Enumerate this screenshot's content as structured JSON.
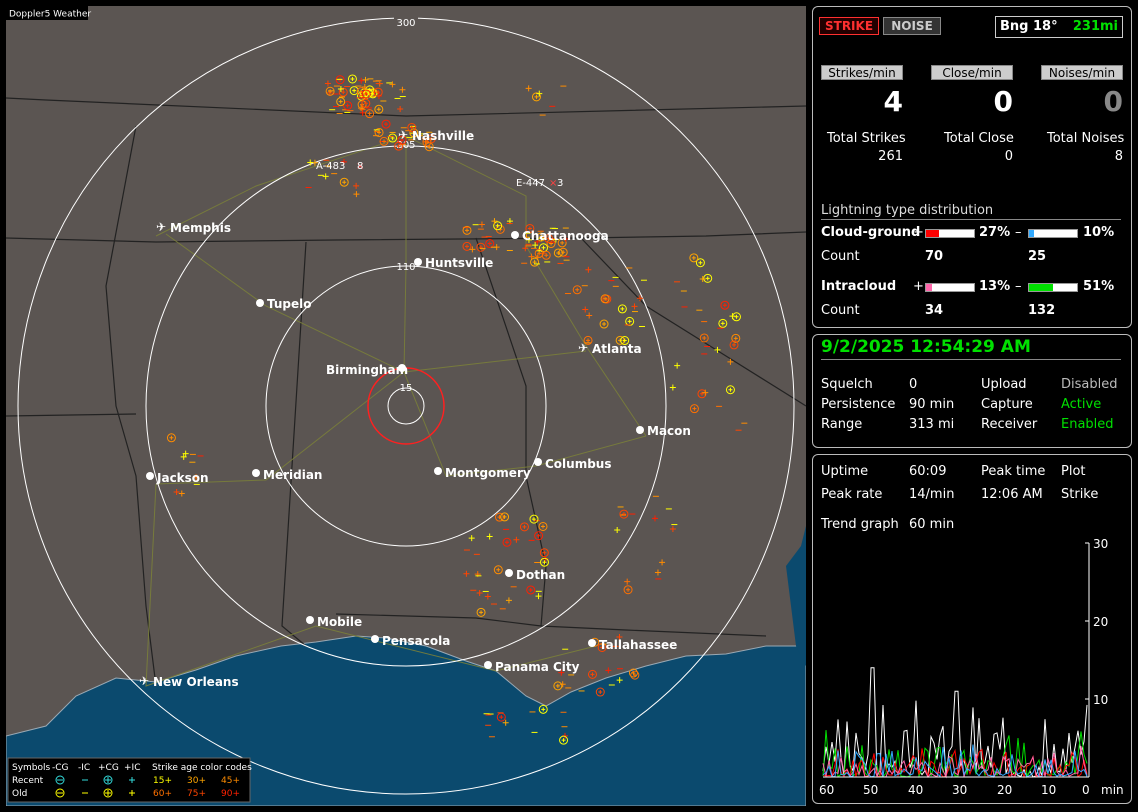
{
  "app_title": "Doppler5 Weather",
  "map": {
    "range_labels": [
      "300",
      "205",
      "110",
      "15"
    ],
    "cities": [
      {
        "name": "Nashville",
        "kind": "airport"
      },
      {
        "name": "Memphis",
        "kind": "airport"
      },
      {
        "name": "Chattanooga",
        "kind": "dot"
      },
      {
        "name": "Huntsville",
        "kind": "dot"
      },
      {
        "name": "Tupelo",
        "kind": "dot"
      },
      {
        "name": "Atlanta",
        "kind": "airport"
      },
      {
        "name": "Birmingham",
        "kind": "dot"
      },
      {
        "name": "Macon",
        "kind": "dot"
      },
      {
        "name": "Jackson",
        "kind": "dot"
      },
      {
        "name": "Meridian",
        "kind": "dot"
      },
      {
        "name": "Montgomery",
        "kind": "dot"
      },
      {
        "name": "Columbus",
        "kind": "dot"
      },
      {
        "name": "Dothan",
        "kind": "dot"
      },
      {
        "name": "Mobile",
        "kind": "dot"
      },
      {
        "name": "Pensacola",
        "kind": "dot"
      },
      {
        "name": "Tallahassee",
        "kind": "dot"
      },
      {
        "name": "Panama City",
        "kind": "dot"
      },
      {
        "name": "New Orleans",
        "kind": "airport"
      }
    ],
    "markers": [
      {
        "name": "A-483",
        "count": "8"
      },
      {
        "name": "E-447",
        "count": "3"
      }
    ],
    "legend": {
      "symbols_label": "Symbols",
      "col_headers": [
        "-CG",
        "-IC",
        "+CG",
        "+IC"
      ],
      "recent_label": "Recent",
      "old_label": "Old",
      "age_title": "Strike age color codes",
      "recent_ages": [
        "15+",
        "30+",
        "45+"
      ],
      "old_ages": [
        "60+",
        "75+",
        "90+"
      ],
      "age_colors": [
        "#ffff00",
        "#ffa500",
        "#ff8c00",
        "#ff7000",
        "#ff4500",
        "#ff2000"
      ]
    }
  },
  "status": {
    "strike_label": "STRIKE",
    "noise_label": "NOISE",
    "bearing": "Bng 18°",
    "distance": "231mi",
    "rates": [
      {
        "label": "Strikes/min",
        "value": "4"
      },
      {
        "label": "Close/min",
        "value": "0"
      },
      {
        "label": "Noises/min",
        "value": "0"
      }
    ],
    "totals": [
      {
        "label": "Total Strikes",
        "value": "261"
      },
      {
        "label": "Total Close",
        "value": "0"
      },
      {
        "label": "Total Noises",
        "value": "8"
      }
    ],
    "distribution_title": "Lightning type distribution",
    "cloud_ground": {
      "label": "Cloud-ground",
      "pos_pct": "27%",
      "neg_pct": "10%",
      "pos_frac": 0.27,
      "neg_frac": 0.1,
      "pos_count": "70",
      "neg_count": "25",
      "pos_color": "#ff0000",
      "neg_color": "#33aaff"
    },
    "intracloud": {
      "label": "Intracloud",
      "pos_pct": "13%",
      "neg_pct": "51%",
      "pos_frac": 0.13,
      "neg_frac": 0.51,
      "pos_count": "34",
      "neg_count": "132",
      "pos_color": "#ff66aa",
      "neg_color": "#00e000"
    },
    "count_label": "Count",
    "plus_sign": "+",
    "minus_sign": "–"
  },
  "info": {
    "datetime": "9/2/2025 12:54:29 AM",
    "rows": [
      {
        "k1": "Squelch",
        "v1": "0",
        "k2": "Upload",
        "v2": "Disabled",
        "v2_color": "#bbbbbb"
      },
      {
        "k1": "Persistence",
        "v1": "90 min",
        "k2": "Capture",
        "v2": "Active",
        "v2_color": "#00e000"
      },
      {
        "k1": "Range",
        "v1": "313 mi",
        "k2": "Receiver",
        "v2": "Enabled",
        "v2_color": "#00e000"
      }
    ]
  },
  "trend": {
    "uptime_label": "Uptime",
    "uptime": "60:09",
    "peak_time_label": "Peak time",
    "peak_time": "12:06 AM",
    "plot_label": "Plot",
    "peak_rate_label": "Peak rate",
    "peak_rate": "14/min",
    "plot_value": "Strike",
    "graph_label": "Trend graph",
    "graph_value": "60 min",
    "y_ticks": [
      "30",
      "20",
      "10"
    ],
    "x_ticks": [
      "60",
      "50",
      "40",
      "30",
      "20",
      "10",
      "0"
    ],
    "x_unit": "min",
    "series_colors": [
      "#ffffff",
      "#00e000",
      "#ff0000",
      "#ff66aa",
      "#33aaff"
    ]
  }
}
